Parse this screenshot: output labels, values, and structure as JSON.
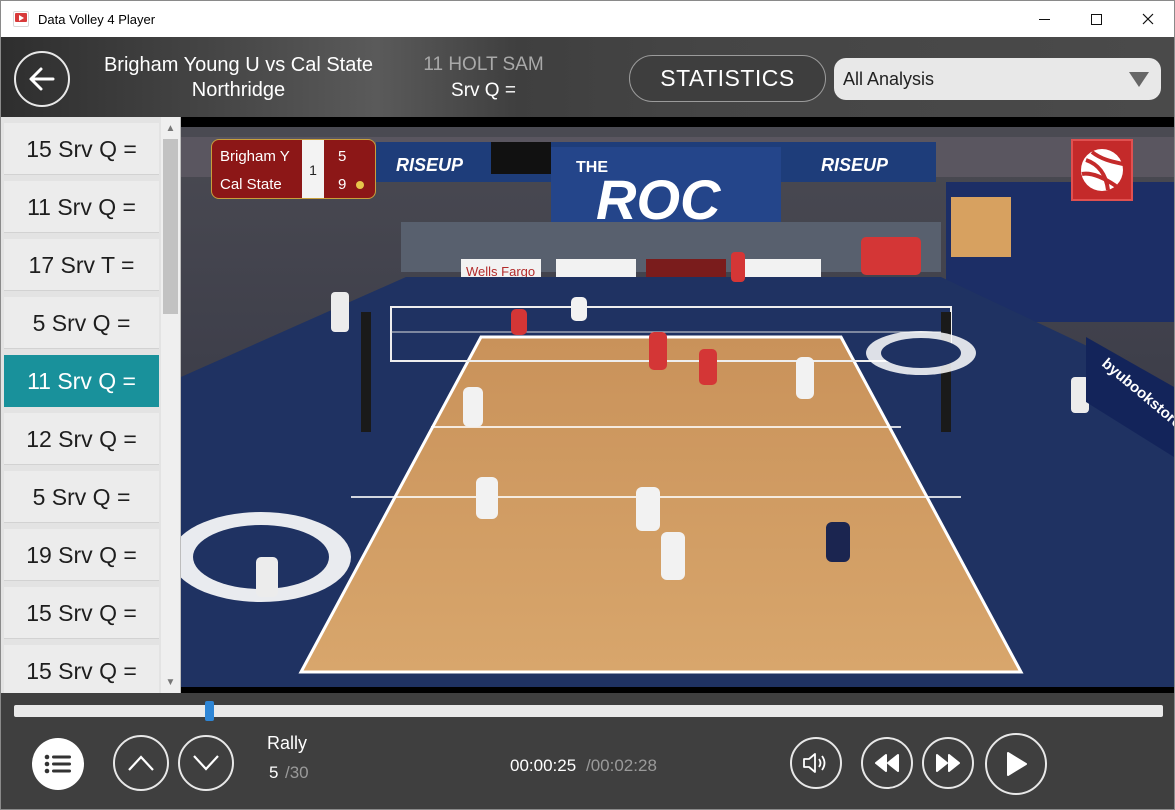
{
  "window": {
    "title": "Data Volley 4 Player",
    "icon": "app-play-icon"
  },
  "header": {
    "match_title_line1": "Brigham Young U vs Cal State",
    "match_title_line2": "Northridge",
    "current_player": "11 HOLT SAM",
    "current_skill": "Srv Q =",
    "statistics_label": "STATISTICS",
    "analysis_selected": "All Analysis"
  },
  "sidebar": {
    "items": [
      {
        "label": "15  Srv Q =",
        "selected": false
      },
      {
        "label": "11  Srv Q =",
        "selected": false
      },
      {
        "label": "17  Srv T =",
        "selected": false
      },
      {
        "label": "5  Srv Q =",
        "selected": false
      },
      {
        "label": "11  Srv Q =",
        "selected": true
      },
      {
        "label": "12  Srv Q =",
        "selected": false
      },
      {
        "label": "5  Srv Q =",
        "selected": false
      },
      {
        "label": "19  Srv Q =",
        "selected": false
      },
      {
        "label": "15  Srv Q =",
        "selected": false
      },
      {
        "label": "15  Srv Q =",
        "selected": false
      }
    ],
    "scroll_up_glyph": "▲",
    "scroll_down_glyph": "▼"
  },
  "video": {
    "scoreboard": {
      "team1": "Brigham Y",
      "team2": "Cal State",
      "set": "1",
      "score1": "5",
      "score2": "9"
    },
    "banners": {
      "riseup_left": "RISEUP",
      "riseup_right": "RISEUP",
      "the": "THE",
      "roc": "ROC",
      "wells_fargo": "Wells Fargo",
      "byu_bookstore": "byubookstore.com"
    }
  },
  "playback": {
    "progress_fraction": 0.17,
    "rally_label": "Rally",
    "rally_current": "5",
    "rally_total": "/30",
    "time_current": "00:00:25",
    "time_total": "/00:02:28"
  },
  "colors": {
    "accent_teal": "#19919b",
    "progress_blue": "#2e86d6",
    "scoreboard_red": "#8c1717"
  }
}
